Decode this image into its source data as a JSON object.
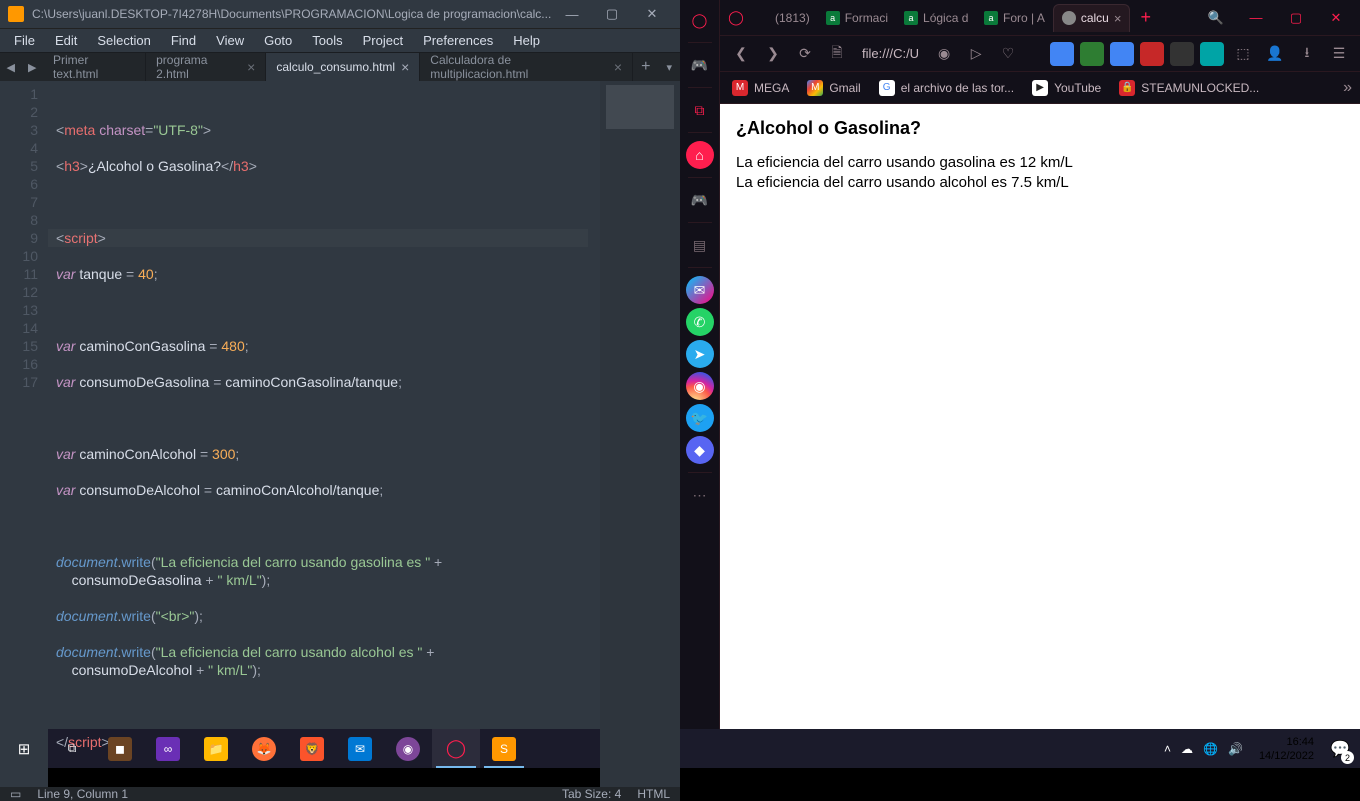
{
  "editor": {
    "title": "C:\\Users\\juanl.DESKTOP-7I4278H\\Documents\\PROGRAMACION\\Logica de programacion\\calc...",
    "menu": [
      "File",
      "Edit",
      "Selection",
      "Find",
      "View",
      "Goto",
      "Tools",
      "Project",
      "Preferences",
      "Help"
    ],
    "tabs": [
      {
        "label": "Primer text.html",
        "active": false
      },
      {
        "label": "programa 2.html",
        "active": false
      },
      {
        "label": "calculo_consumo.html",
        "active": true
      },
      {
        "label": "Calculadora de multiplicacion.html",
        "active": false
      }
    ],
    "gutter": [
      "1",
      "2",
      "3",
      "4",
      "5",
      "6",
      "7",
      "8",
      "9",
      "10",
      "11",
      "12",
      "13",
      "14",
      "15",
      "16",
      "17"
    ],
    "status": {
      "left": "Line 9, Column 1",
      "tab": "Tab Size: 4",
      "lang": "HTML"
    },
    "currentLineIdx": 8,
    "code": {
      "l1": {
        "meta": "meta",
        "charset": "charset",
        "utf": "\"UTF-8\""
      },
      "l2": {
        "h3o": "h3",
        "txt": "¿Alcohol o Gasolina?",
        "h3c": "h3"
      },
      "l4": {
        "script": "script"
      },
      "l5": {
        "var": "var",
        "name": "tanque",
        "eq": " = ",
        "num": "40"
      },
      "l7": {
        "var": "var",
        "name": "caminoConGasolina",
        "eq": " = ",
        "num": "480"
      },
      "l8": {
        "var": "var",
        "name": "consumoDeGasolina",
        "eq": " = ",
        "rhs": "caminoConGasolina/tanque"
      },
      "l10": {
        "var": "var",
        "name": "caminoConAlcohol",
        "eq": " = ",
        "num": "300"
      },
      "l11": {
        "var": "var",
        "name": "consumoDeAlcohol",
        "eq": " = ",
        "rhs": "caminoConAlcohol/tanque"
      },
      "l13": {
        "obj": "document",
        "fn": "write",
        "str": "\"La eficiencia del carro usando gasolina es \"",
        "plus": " + "
      },
      "l13b": {
        "var": "consumoDeGasolina",
        "plus": " + ",
        "str": "\" km/L\""
      },
      "l14": {
        "obj": "document",
        "fn": "write",
        "str": "\"<br>\""
      },
      "l15": {
        "obj": "document",
        "fn": "write",
        "str": "\"La eficiencia del carro usando alcohol es \"",
        "plus": " + "
      },
      "l15b": {
        "var": "consumoDeAlcohol",
        "plus": " + ",
        "str": "\" km/L\""
      },
      "l17": {
        "script": "script"
      }
    }
  },
  "browser": {
    "tabs": [
      {
        "label": "(1813)",
        "ico": "#ff0000"
      },
      {
        "label": "Formaci",
        "ico": "#0a7a3a"
      },
      {
        "label": "Lógica d",
        "ico": "#0a7a3a"
      },
      {
        "label": "Foro | A",
        "ico": "#0a7a3a"
      },
      {
        "label": "calcu",
        "ico": "#888",
        "active": true
      }
    ],
    "url": "file:///C:/U",
    "bookmarks": [
      {
        "label": "MEGA",
        "bg": "#d9272e"
      },
      {
        "label": "Gmail",
        "bg": "#ea4335"
      },
      {
        "label": "el archivo de las tor...",
        "bg": "#fff"
      },
      {
        "label": "YouTube",
        "bg": "#fff"
      },
      {
        "label": "STEAMUNLOCKED...",
        "bg": "#d9272e"
      }
    ],
    "page": {
      "heading": "¿Alcohol o Gasolina?",
      "line1": "La eficiencia del carro usando gasolina es 12 km/L",
      "line2": "La eficiencia del carro usando alcohol es 7.5 km/L"
    }
  },
  "taskbar": {
    "time": "16:44",
    "date": "14/12/2022",
    "notif": "2"
  }
}
